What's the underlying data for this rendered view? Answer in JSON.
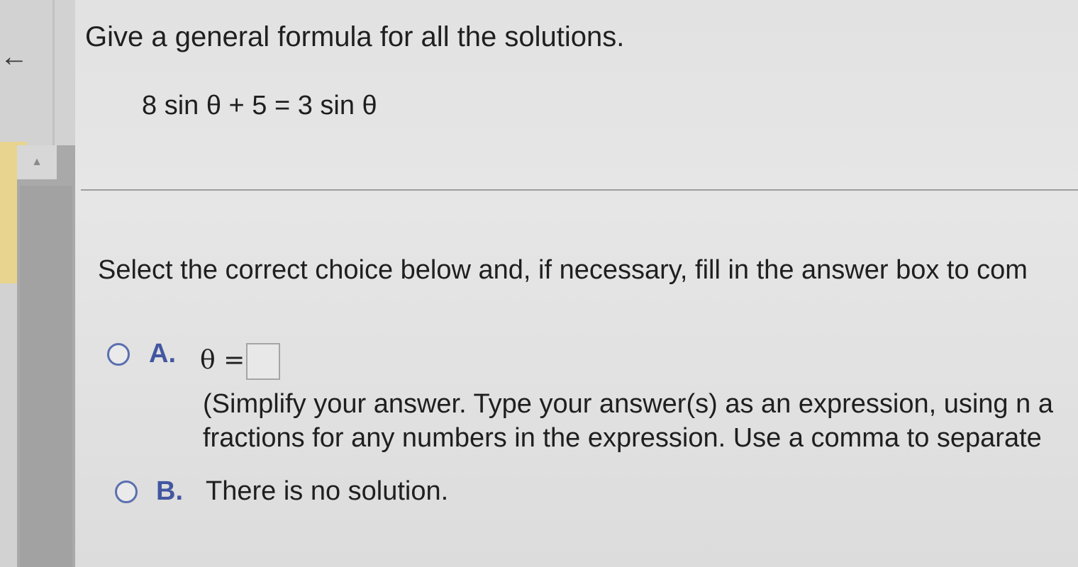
{
  "question": {
    "title": "Give a general formula for all the solutions.",
    "equation": "8 sin θ + 5 = 3 sin θ"
  },
  "instruction": "Select the correct choice below and, if necessary, fill in the answer box to com",
  "options": [
    {
      "letter": "A.",
      "prefix": "θ =",
      "answer_value": "",
      "hint_line1": "(Simplify your answer. Type your answer(s) as an expression, using n a",
      "hint_line2": "fractions for any numbers in the expression. Use a comma to separate"
    },
    {
      "letter": "B.",
      "text": "There is no solution."
    }
  ],
  "nav": {
    "back_icon": "back-arrow-icon",
    "scroll_up_icon": "triangle-up-icon"
  },
  "colors": {
    "accent": "#4257a0",
    "sidebar_highlight": "#e8d48e"
  }
}
